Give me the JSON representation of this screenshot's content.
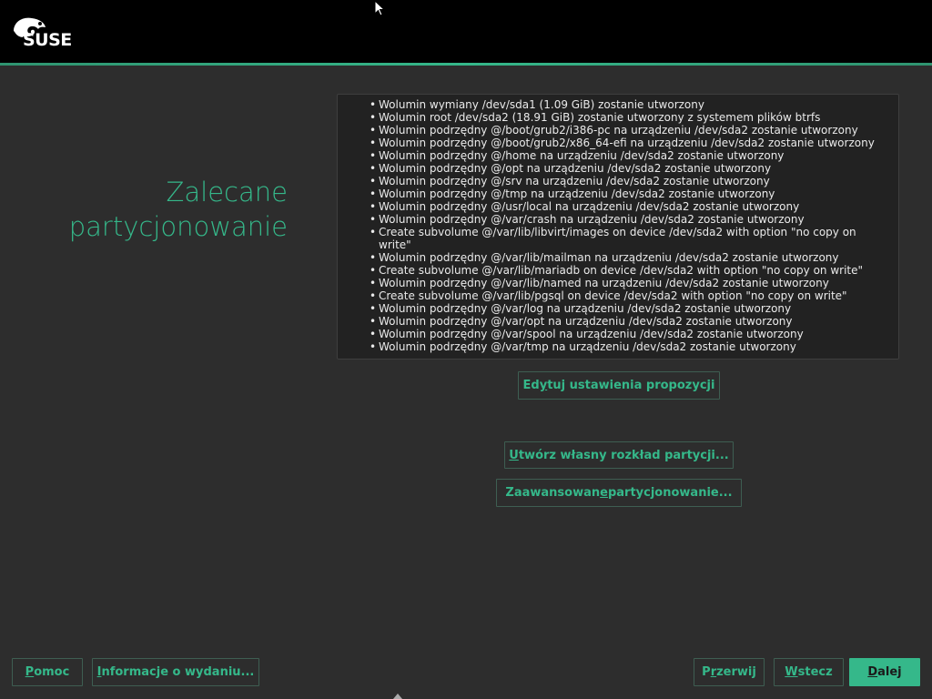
{
  "header": {
    "logo_text": "SUSE"
  },
  "page": {
    "title_line1": "Zalecane",
    "title_line2": "partycjonowanie"
  },
  "proposal": {
    "items": [
      "Wolumin wymiany /dev/sda1 (1.09 GiB) zostanie utworzony",
      "Wolumin root /dev/sda2 (18.91 GiB) zostanie utworzony z systemem plików btrfs",
      "Wolumin podrzędny @/boot/grub2/i386-pc na urządzeniu /dev/sda2 zostanie utworzony",
      "Wolumin podrzędny @/boot/grub2/x86_64-efi na urządzeniu /dev/sda2 zostanie utworzony",
      "Wolumin podrzędny @/home na urządzeniu /dev/sda2 zostanie utworzony",
      "Wolumin podrzędny @/opt na urządzeniu /dev/sda2 zostanie utworzony",
      "Wolumin podrzędny @/srv na urządzeniu /dev/sda2 zostanie utworzony",
      "Wolumin podrzędny @/tmp na urządzeniu /dev/sda2 zostanie utworzony",
      "Wolumin podrzędny @/usr/local na urządzeniu /dev/sda2 zostanie utworzony",
      "Wolumin podrzędny @/var/crash na urządzeniu /dev/sda2 zostanie utworzony",
      "Create subvolume @/var/lib/libvirt/images on device /dev/sda2 with option \"no copy on write\"",
      "Wolumin podrzędny @/var/lib/mailman na urządzeniu /dev/sda2 zostanie utworzony",
      "Create subvolume @/var/lib/mariadb on device /dev/sda2 with option \"no copy on write\"",
      "Wolumin podrzędny @/var/lib/named na urządzeniu /dev/sda2 zostanie utworzony",
      "Create subvolume @/var/lib/pgsql on device /dev/sda2 with option \"no copy on write\"",
      "Wolumin podrzędny @/var/log na urządzeniu /dev/sda2 zostanie utworzony",
      "Wolumin podrzędny @/var/opt na urządzeniu /dev/sda2 zostanie utworzony",
      "Wolumin podrzędny @/var/spool na urządzeniu /dev/sda2 zostanie utworzony",
      "Wolumin podrzędny @/var/tmp na urządzeniu /dev/sda2 zostanie utworzony"
    ]
  },
  "buttons": {
    "edit_proposal": {
      "pre": "Ed",
      "u": "y",
      "post": "tuj ustawienia propozycji"
    },
    "custom_layout": {
      "pre": "",
      "u": "U",
      "post": "twórz własny rozkład partycji..."
    },
    "expert": {
      "pre": "Zaawansowan",
      "u": "e",
      "post": " partycjonowanie..."
    },
    "help": {
      "pre": "",
      "u": "P",
      "post": "omoc"
    },
    "release_notes": {
      "pre": "",
      "u": "I",
      "post": "nformacje o wydaniu..."
    },
    "abort": {
      "pre": "P",
      "u": "r",
      "post": "zerwij"
    },
    "back": {
      "pre": "",
      "u": "W",
      "post": "stecz"
    },
    "next": {
      "pre": "",
      "u": "D",
      "post": "alej"
    }
  },
  "colors": {
    "accent": "#35b88a",
    "background": "#2d2d2d",
    "header": "#000000"
  },
  "icons": [
    "suse-chameleon-logo-icon",
    "mouse-cursor-icon"
  ]
}
